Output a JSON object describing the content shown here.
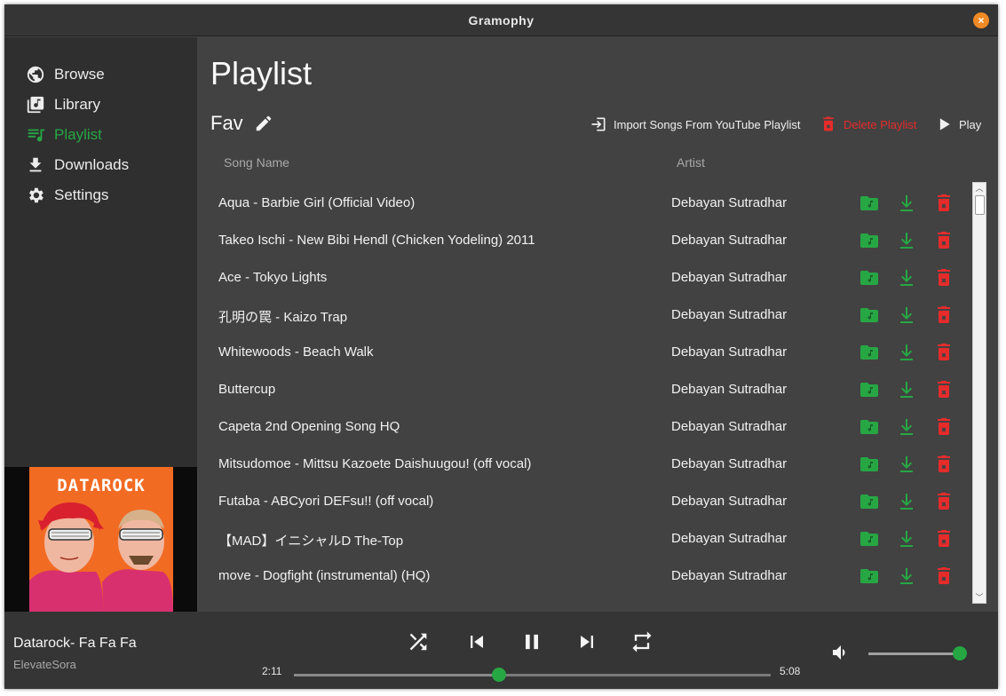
{
  "window": {
    "title": "Gramophy",
    "close_glyph": "×"
  },
  "sidebar": {
    "items": [
      {
        "label": "Browse",
        "icon": "globe-icon"
      },
      {
        "label": "Library",
        "icon": "music-library-icon"
      },
      {
        "label": "Playlist",
        "icon": "playlist-icon",
        "active": true
      },
      {
        "label": "Downloads",
        "icon": "download-icon"
      },
      {
        "label": "Settings",
        "icon": "gear-icon"
      }
    ],
    "album_art": {
      "text": "DATAROCK"
    }
  },
  "main": {
    "title": "Playlist",
    "playlist_name": "Fav",
    "actions": {
      "import": "Import Songs From YouTube Playlist",
      "delete": "Delete Playlist",
      "play": "Play"
    },
    "columns": {
      "song": "Song Name",
      "artist": "Artist"
    },
    "rows": [
      {
        "song": "Aqua - Barbie Girl (Official Video)",
        "artist": "Debayan Sutradhar"
      },
      {
        "song": "Takeo Ischi - New Bibi Hendl (Chicken Yodeling) 2011",
        "artist": "Debayan Sutradhar"
      },
      {
        "song": "Ace - Tokyo Lights",
        "artist": "Debayan Sutradhar"
      },
      {
        "song": "孔明の罠 - Kaizo Trap",
        "artist": "Debayan Sutradhar"
      },
      {
        "song": "Whitewoods - Beach Walk",
        "artist": "Debayan Sutradhar"
      },
      {
        "song": "Buttercup",
        "artist": "Debayan Sutradhar"
      },
      {
        "song": "Capeta 2nd Opening Song HQ",
        "artist": "Debayan Sutradhar"
      },
      {
        "song": "Mitsudomoe - Mittsu Kazoete Daishuugou! (off vocal)",
        "artist": "Debayan Sutradhar"
      },
      {
        "song": "Futaba - ABCyori DEFsu!! (off vocal)",
        "artist": "Debayan Sutradhar"
      },
      {
        "song": "【MAD】イニシャルD The-Top",
        "artist": "Debayan Sutradhar"
      },
      {
        "song": "move - Dogfight (instrumental) (HQ)",
        "artist": "Debayan Sutradhar"
      }
    ]
  },
  "player": {
    "title": "Datarock- Fa Fa Fa",
    "artist": "ElevateSora",
    "elapsed": "2:11",
    "duration": "5:08",
    "progress": 0.43,
    "volume": 1.0
  },
  "colors": {
    "accent": "#27a744",
    "danger": "#e62b2b",
    "background": "#424242",
    "sidebar": "#2f2f2f"
  }
}
